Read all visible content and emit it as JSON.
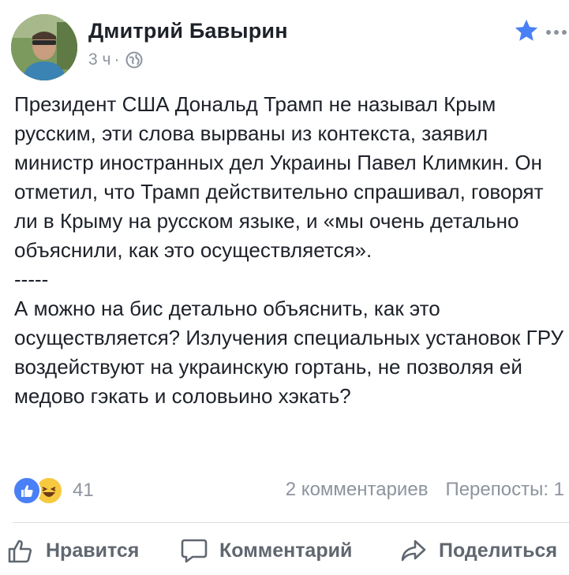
{
  "post": {
    "author": "Дмитрий Бавырин",
    "time": "3 ч",
    "separator": "·",
    "text": "Президент США Дональд Трамп не называл Крым русским, эти слова вырваны из контекста, заявил министр иностранных дел Украины Павел Климкин. Он отметил, что Трамп действительно спрашивал, говорят ли в Крыму на русском языке, и «мы очень детально объяснили, как это осуществляется».\n-----\nА можно на бис детально объяснить, как это осуществляется? Излучения специальных установок ГРУ воздействуют на украинскую гортань, не позволяя ей медово гэкать и соловьино хэкать?"
  },
  "reactions": {
    "count": "41",
    "types": [
      "like-icon",
      "haha-icon"
    ]
  },
  "stats": {
    "comments": "2 комментариев",
    "shares": "Перепосты: 1"
  },
  "actions": {
    "like": "Нравится",
    "comment": "Комментарий",
    "share": "Поделиться"
  },
  "colors": {
    "accent": "#4a80f5",
    "star": "#4a80f5",
    "muted": "#8d949e",
    "action": "#606770"
  }
}
